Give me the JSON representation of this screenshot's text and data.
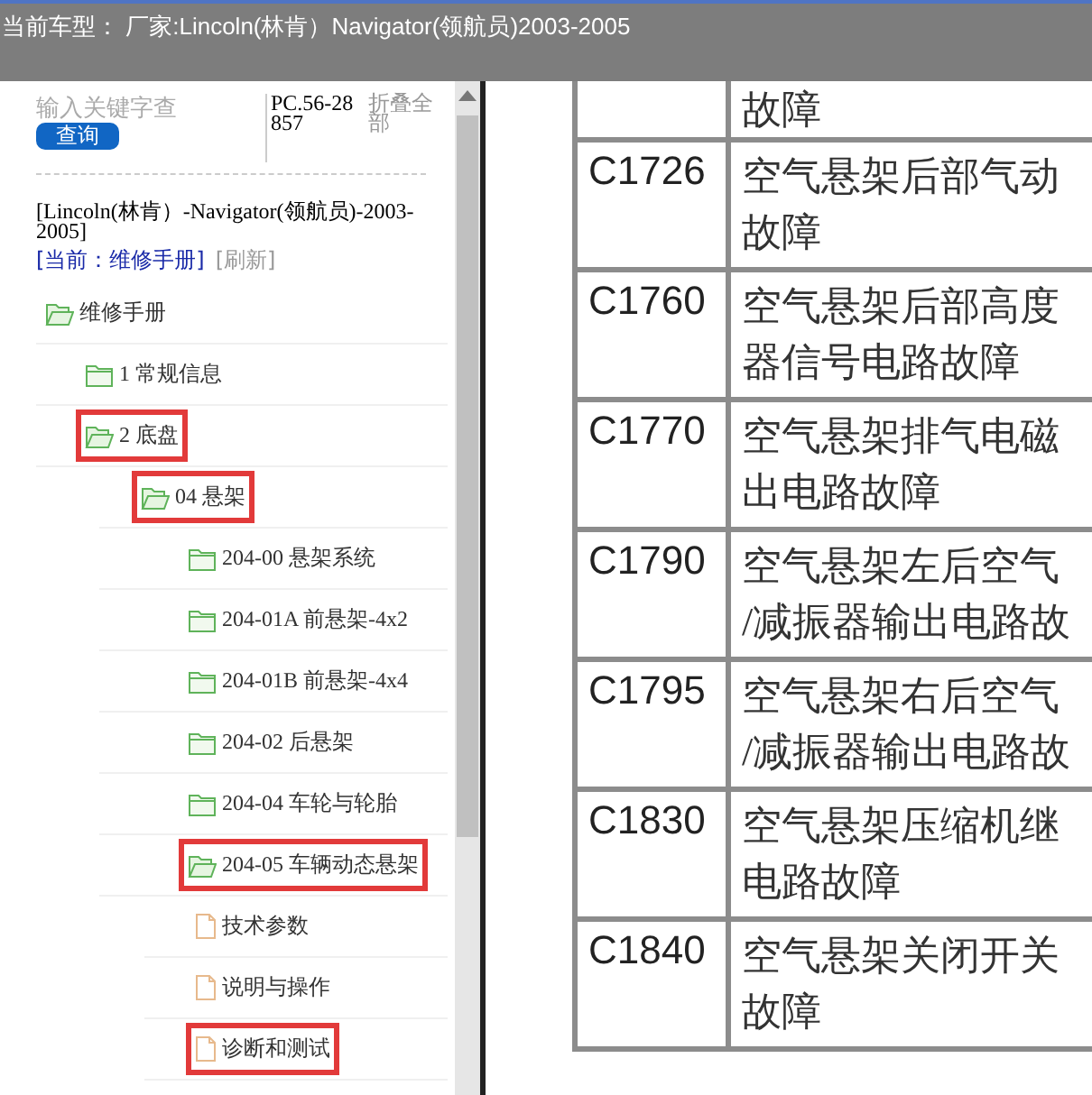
{
  "window": {
    "title": "当前车型： 厂家:Lincoln(林肯）Navigator(领航员)2003-2005"
  },
  "sidebar": {
    "search": {
      "placeholder": "输入关键字查"
    },
    "search_button": "查询",
    "code": "PC.56-28857",
    "collapse_all": "折叠全部",
    "vehicle": "[Lincoln(林肯）-Navigator(领航员)-2003-2005]",
    "current": "[当前：维修手册]",
    "refresh": "[刷新]",
    "tree": [
      {
        "kind": "folder",
        "label": "维修手册",
        "expanded": true,
        "highlighted": false,
        "children": [
          {
            "kind": "folder",
            "label": "1 常规信息",
            "expanded": false,
            "highlighted": false
          },
          {
            "kind": "folder",
            "label": "2 底盘",
            "expanded": true,
            "highlighted": true,
            "children": [
              {
                "kind": "folder",
                "label": "04 悬架",
                "expanded": true,
                "highlighted": true,
                "children": [
                  {
                    "kind": "folder",
                    "label": "204-00 悬架系统",
                    "expanded": false,
                    "highlighted": false
                  },
                  {
                    "kind": "folder",
                    "label": "204-01A 前悬架-4x2",
                    "expanded": false,
                    "highlighted": false
                  },
                  {
                    "kind": "folder",
                    "label": "204-01B 前悬架-4x4",
                    "expanded": false,
                    "highlighted": false
                  },
                  {
                    "kind": "folder",
                    "label": "204-02 后悬架",
                    "expanded": false,
                    "highlighted": false
                  },
                  {
                    "kind": "folder",
                    "label": "204-04 车轮与轮胎",
                    "expanded": false,
                    "highlighted": false
                  },
                  {
                    "kind": "folder",
                    "label": "204-05 车辆动态悬架",
                    "expanded": true,
                    "highlighted": true,
                    "children": [
                      {
                        "kind": "doc",
                        "label": "技术参数",
                        "highlighted": false
                      },
                      {
                        "kind": "doc",
                        "label": "说明与操作",
                        "highlighted": false
                      },
                      {
                        "kind": "doc",
                        "label": "诊断和测试",
                        "highlighted": true
                      }
                    ]
                  }
                ]
              }
            ]
          }
        ]
      }
    ]
  },
  "table": {
    "rows": [
      {
        "code": "",
        "lines": [
          "故障"
        ]
      },
      {
        "code": "C1726",
        "lines": [
          "空气悬架后部气动",
          "故障"
        ]
      },
      {
        "code": "C1760",
        "lines": [
          "空气悬架后部高度",
          "器信号电路故障"
        ]
      },
      {
        "code": "C1770",
        "lines": [
          "空气悬架排气电磁",
          "出电路故障"
        ]
      },
      {
        "code": "C1790",
        "lines": [
          "空气悬架左后空气",
          "/减振器输出电路故"
        ]
      },
      {
        "code": "C1795",
        "lines": [
          "空气悬架右后空气",
          "/减振器输出电路故"
        ]
      },
      {
        "code": "C1830",
        "lines": [
          "空气悬架压缩机继",
          "电路故障"
        ]
      },
      {
        "code": "C1840",
        "lines": [
          "空气悬架关闭开关",
          "故障"
        ]
      }
    ]
  }
}
